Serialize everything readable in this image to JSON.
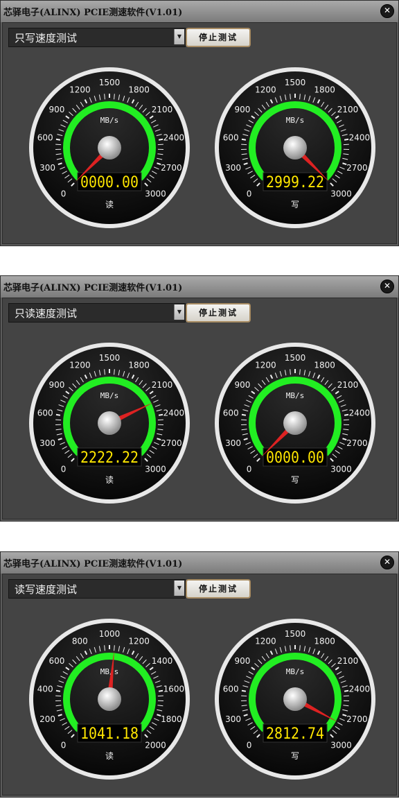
{
  "windows": [
    {
      "title": "芯驿电子(ALINX) PCIE测速软件(V1.01)",
      "mode": "只写速度测试",
      "button": "停止测试",
      "gauges": [
        {
          "unit": "MB/s",
          "label": "读",
          "value": 0,
          "display": "0000.00",
          "max": 3000,
          "ticks": [
            "0",
            "300",
            "600",
            "900",
            "1200",
            "1500",
            "1800",
            "2100",
            "2400",
            "2700",
            "3000"
          ]
        },
        {
          "unit": "MB/s",
          "label": "写",
          "value": 2999.22,
          "display": "2999.22",
          "max": 3000,
          "ticks": [
            "0",
            "300",
            "600",
            "900",
            "1200",
            "1500",
            "1800",
            "2100",
            "2400",
            "2700",
            "3000"
          ]
        }
      ]
    },
    {
      "title": "芯驿电子(ALINX) PCIE测速软件(V1.01)",
      "mode": "只读速度测试",
      "button": "停止测试",
      "gauges": [
        {
          "unit": "MB/s",
          "label": "读",
          "value": 2222.22,
          "display": "2222.22",
          "max": 3000,
          "ticks": [
            "0",
            "300",
            "600",
            "900",
            "1200",
            "1500",
            "1800",
            "2100",
            "2400",
            "2700",
            "3000"
          ]
        },
        {
          "unit": "MB/s",
          "label": "写",
          "value": 0,
          "display": "0000.00",
          "max": 3000,
          "ticks": [
            "0",
            "300",
            "600",
            "900",
            "1200",
            "1500",
            "1800",
            "2100",
            "2400",
            "2700",
            "3000"
          ]
        }
      ]
    },
    {
      "title": "芯驿电子(ALINX) PCIE测速软件(V1.01)",
      "mode": "读写速度测试",
      "button": "停止测试",
      "gauges": [
        {
          "unit": "MB/s",
          "label": "读",
          "value": 1041.18,
          "display": "1041.18",
          "max": 2000,
          "ticks": [
            "0",
            "200",
            "400",
            "600",
            "800",
            "1000",
            "1200",
            "1400",
            "1600",
            "1800",
            "2000"
          ]
        },
        {
          "unit": "MB/s",
          "label": "写",
          "value": 2812.74,
          "display": "2812.74",
          "max": 3000,
          "ticks": [
            "0",
            "300",
            "600",
            "900",
            "1200",
            "1500",
            "1800",
            "2100",
            "2400",
            "2700",
            "3000"
          ]
        }
      ]
    }
  ],
  "colors": {
    "arc": "#22ee22",
    "needle": "#dd2222",
    "display_text": "#ffe600"
  }
}
